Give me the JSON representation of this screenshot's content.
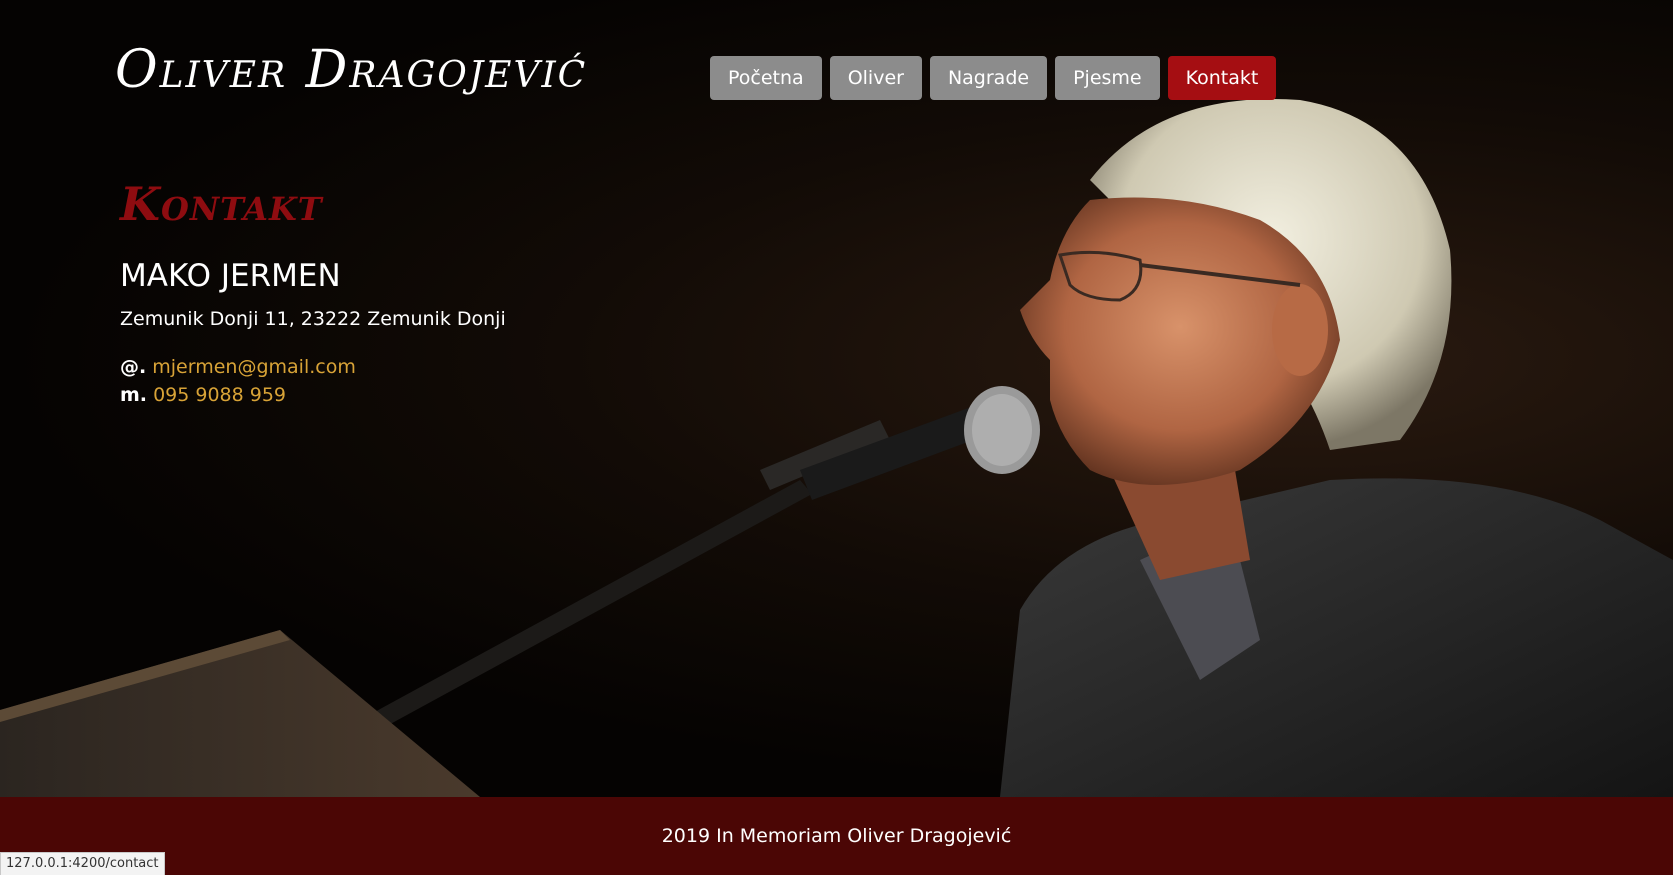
{
  "site": {
    "logo": "Oliver Dragojević"
  },
  "nav": {
    "items": [
      {
        "label": "Početna",
        "active": false
      },
      {
        "label": "Oliver",
        "active": false
      },
      {
        "label": "Nagrade",
        "active": false
      },
      {
        "label": "Pjesme",
        "active": false
      },
      {
        "label": "Kontakt",
        "active": true
      }
    ]
  },
  "contact": {
    "title": "Kontakt",
    "name": "MAKO JERMEN",
    "address": "Zemunik Donji 11, 23222 Zemunik Donji",
    "email_label": "@.",
    "email": "mjermen@gmail.com",
    "phone_label": "m.",
    "phone": "095 9088 959"
  },
  "footer": {
    "text": "2019 In Memoriam Oliver Dragojević"
  },
  "status_bar": {
    "url": "127.0.0.1:4200/contact"
  },
  "colors": {
    "active_nav": "#a50e12",
    "nav": "#8c8c8c",
    "title": "#8e0c10",
    "link": "#d8a337",
    "footer_bg": "#4b0605"
  }
}
